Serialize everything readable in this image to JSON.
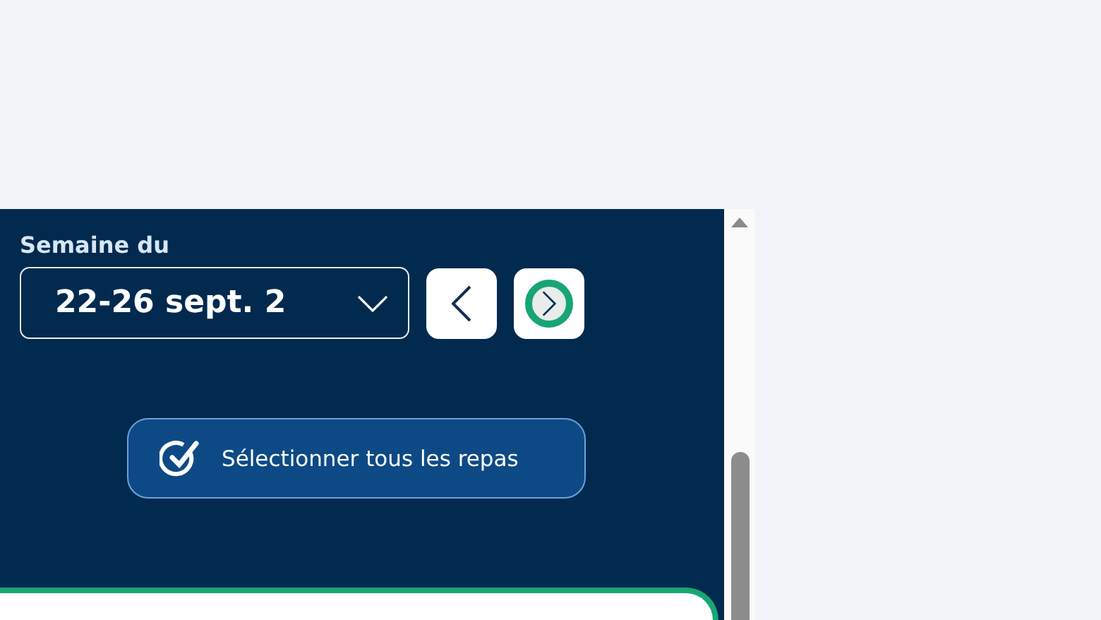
{
  "week_label": "Semaine du",
  "week_select": {
    "value": "22-26 sept. 2"
  },
  "nav_buttons": [
    {
      "kind": "previous",
      "focused": false
    },
    {
      "kind": "next",
      "focused": true
    }
  ],
  "select_all_button": {
    "label": "Sélectionner tous les repas"
  }
}
